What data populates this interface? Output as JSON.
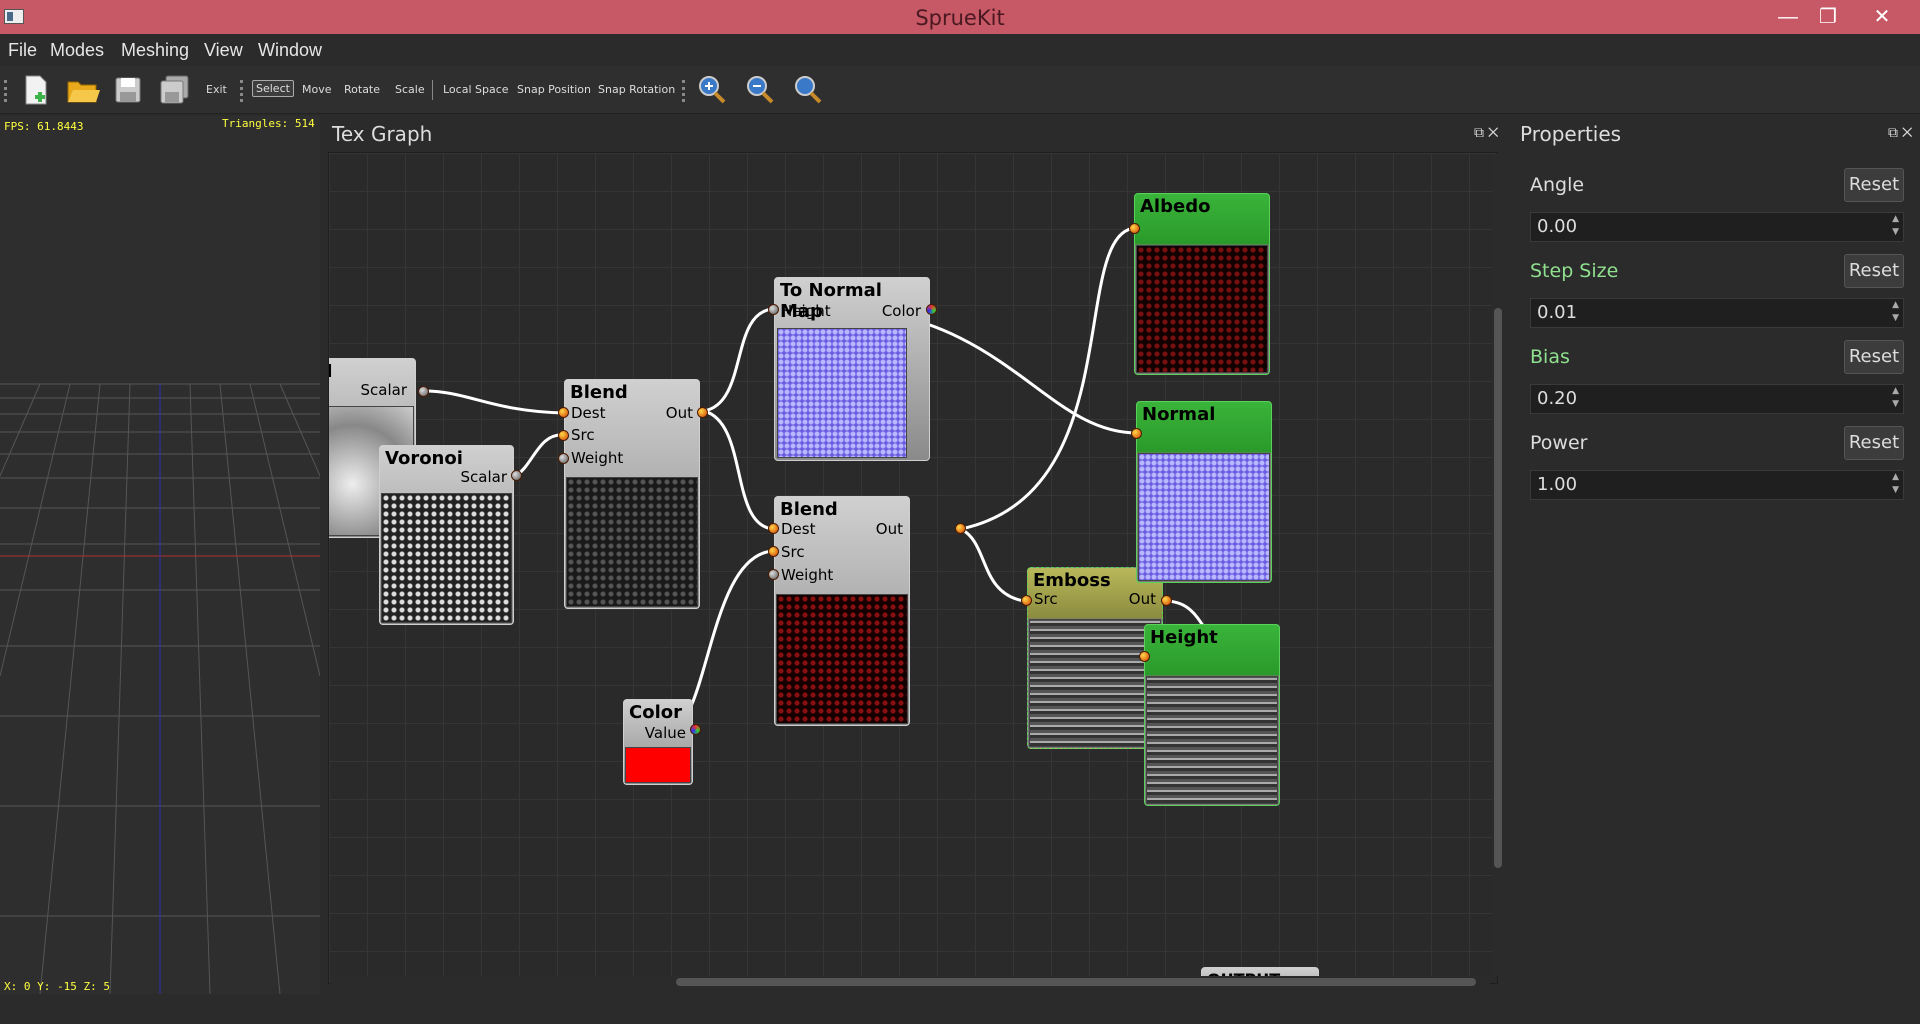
{
  "window": {
    "title": "SprueKit",
    "minimize": "—",
    "restore": "❐",
    "close": "✕"
  },
  "menu": [
    "File",
    "Modes",
    "Meshing",
    "View",
    "Window"
  ],
  "toolbar": {
    "exit": "Exit",
    "select": "Select",
    "move": "Move",
    "rotate": "Rotate",
    "scale": "Scale",
    "local_space": "Local Space",
    "snap_position": "Snap Position",
    "snap_rotation": "Snap Rotation"
  },
  "viewport": {
    "fps": "FPS: 61.8443",
    "triangles": "Triangles: 514",
    "coords": "X: 0 Y: -15 Z: 5"
  },
  "texgraph": {
    "title": "Tex Graph",
    "nodes": {
      "partial": {
        "port": "Scalar",
        "title_fragment": "I"
      },
      "voronoi": {
        "title": "Voronoi",
        "port": "Scalar"
      },
      "blend1": {
        "title": "Blend",
        "dest": "Dest",
        "src": "Src",
        "weight": "Weight",
        "out": "Out"
      },
      "normalmap": {
        "title": "To Normal Map",
        "height": "Height",
        "color": "Color"
      },
      "blend2": {
        "title": "Blend",
        "dest": "Dest",
        "src": "Src",
        "weight": "Weight",
        "out": "Out"
      },
      "color": {
        "title": "Color",
        "value": "Value",
        "swatch": "#ff0000"
      },
      "emboss": {
        "title": "Emboss",
        "src": "Src",
        "out": "Out"
      },
      "albedo": {
        "title": "Albedo"
      },
      "normal": {
        "title": "Normal"
      },
      "height": {
        "title": "Height"
      },
      "output": {
        "title": "OUTPUT"
      }
    }
  },
  "properties": {
    "title": "Properties",
    "reset": "Reset",
    "items": [
      {
        "label": "Angle",
        "value": "0.00",
        "color": "#dddddd"
      },
      {
        "label": "Step Size",
        "value": "0.01",
        "color": "#8fe08f"
      },
      {
        "label": "Bias",
        "value": "0.20",
        "color": "#8fe08f"
      },
      {
        "label": "Power",
        "value": "1.00",
        "color": "#dddddd"
      }
    ]
  }
}
